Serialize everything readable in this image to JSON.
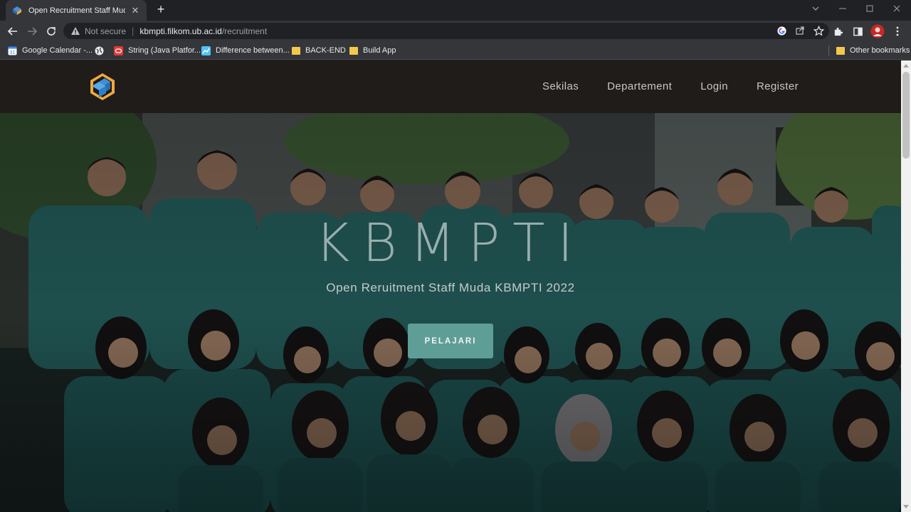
{
  "browser": {
    "tab": {
      "title": "Open Recruitment Staff Muda KBMPTI",
      "close": "✕"
    },
    "new_tab": "+",
    "address": {
      "security_label": "Not secure",
      "separator": "|",
      "host": "kbmpti.filkom.ub.ac.id",
      "path": "/recruitment"
    },
    "bookmarks": [
      {
        "label": "Google Calendar -...",
        "icon": "google-calendar-icon"
      },
      {
        "label": "",
        "icon": "globe-icon"
      },
      {
        "label": "String (Java Platfor...",
        "icon": "oracle-icon"
      },
      {
        "label": "Difference between...",
        "icon": "chart-icon"
      },
      {
        "label": "BACK-END",
        "icon": "folder-icon"
      },
      {
        "label": "Build App",
        "icon": "folder-icon"
      }
    ],
    "other_bookmarks": "Other bookmarks"
  },
  "site": {
    "nav": {
      "items": [
        {
          "label": "Sekilas"
        },
        {
          "label": "Departement"
        },
        {
          "label": "Login"
        },
        {
          "label": "Register"
        }
      ]
    },
    "hero": {
      "title": "KBMPTI",
      "subtitle": "Open Reruitment Staff Muda KBMPTI 2022",
      "button": "PELAJARI"
    }
  },
  "colors": {
    "accent_button": "#5e9e97",
    "nav_background": "#201c1a",
    "uniform": "#1f5c5a"
  }
}
